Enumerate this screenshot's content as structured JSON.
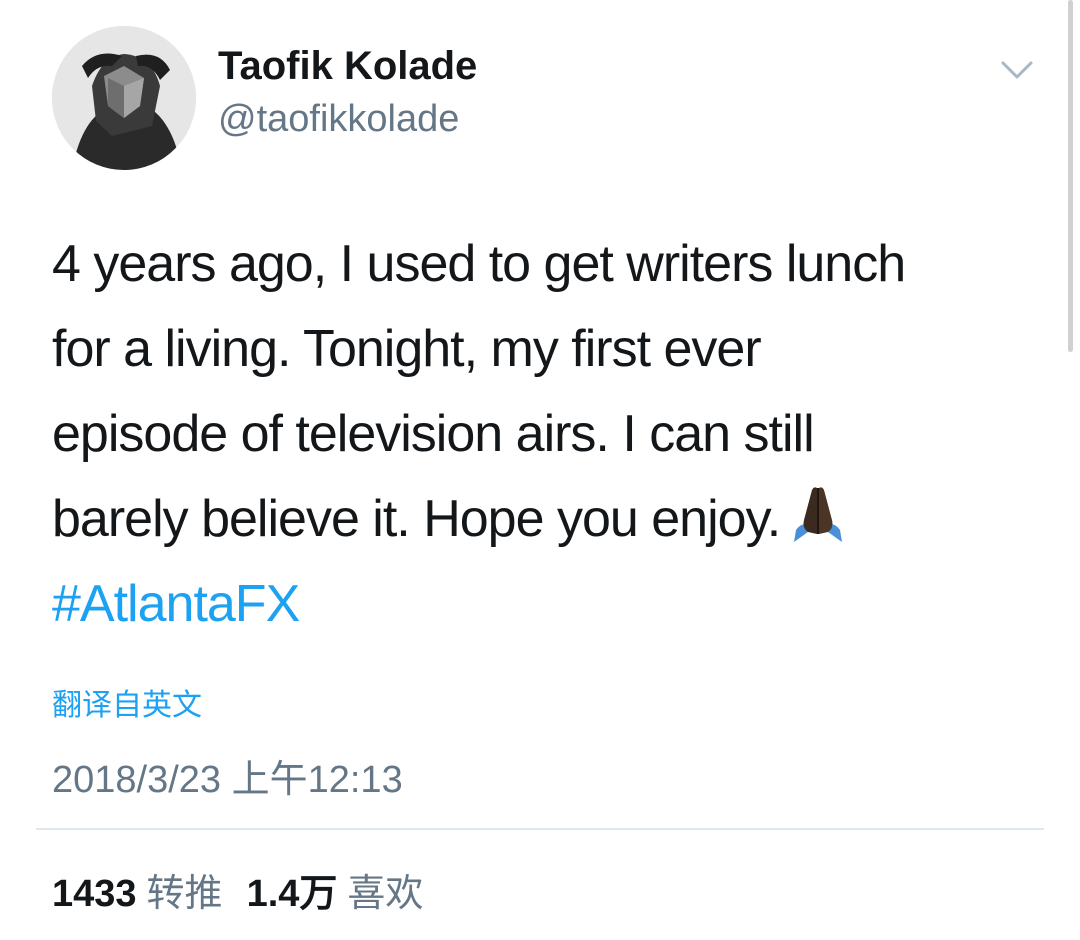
{
  "author": {
    "display_name": "Taofik Kolade",
    "handle": "@taofikkolade"
  },
  "menu_icon": "chevron-down-icon",
  "tweet": {
    "lines": [
      "4 years ago, I used to get writers lunch",
      "for a living. Tonight, my first ever",
      "episode of television airs. I can still",
      "barely believe it. Hope you enjoy."
    ],
    "emoji": "folded-hands-icon",
    "hashtag": "#AtlantaFX"
  },
  "translate_label": "翻译自英文",
  "timestamp": "2018/3/23 上午12:13",
  "stats": {
    "retweets_count": "1433",
    "retweets_label": "转推",
    "likes_count": "1.4万",
    "likes_label": "喜欢"
  },
  "colors": {
    "link": "#1da1f2",
    "secondary_text": "#657786",
    "primary_text": "#14171a",
    "divider": "#e1e8ed"
  }
}
